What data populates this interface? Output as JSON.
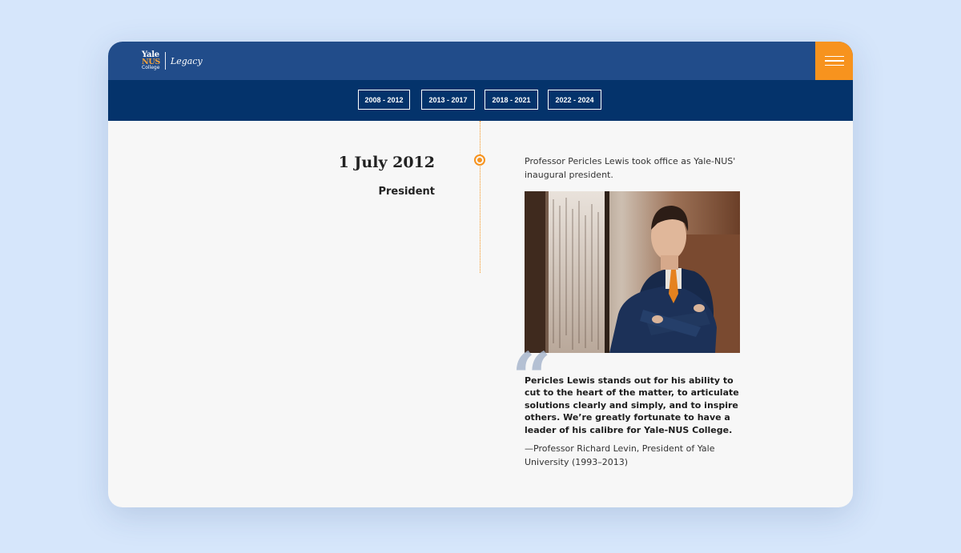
{
  "brand": {
    "logo_yale": "Yale",
    "logo_nus": "NUS",
    "logo_college": "College",
    "logo_legacy": "Legacy"
  },
  "nav": {
    "periods": [
      "2008 - 2012",
      "2013 - 2017",
      "2018 - 2021",
      "2022 - 2024"
    ]
  },
  "entry": {
    "date": "1 July 2012",
    "role": "President",
    "intro": "Professor Pericles Lewis took office as Yale-NUS' inaugural president.",
    "quote": "Pericles Lewis stands out for his ability to cut to the heart of the matter, to articulate solutions clearly and simply, and to inspire others. We’re greatly fortunate to have a leader of his calibre for Yale-NUS College.",
    "attribution": "—Professor Richard Levin, President of Yale University (1993–2013)"
  },
  "icons": {
    "menu": "hamburger-menu-icon",
    "timeline_marker": "timeline-marker-icon",
    "quote": "quote-mark-icon"
  },
  "colors": {
    "topbar": "#214c8a",
    "subnav": "#04336b",
    "accent": "#f7931e",
    "background": "#d6e6fb",
    "content_bg": "#f7f7f7"
  }
}
